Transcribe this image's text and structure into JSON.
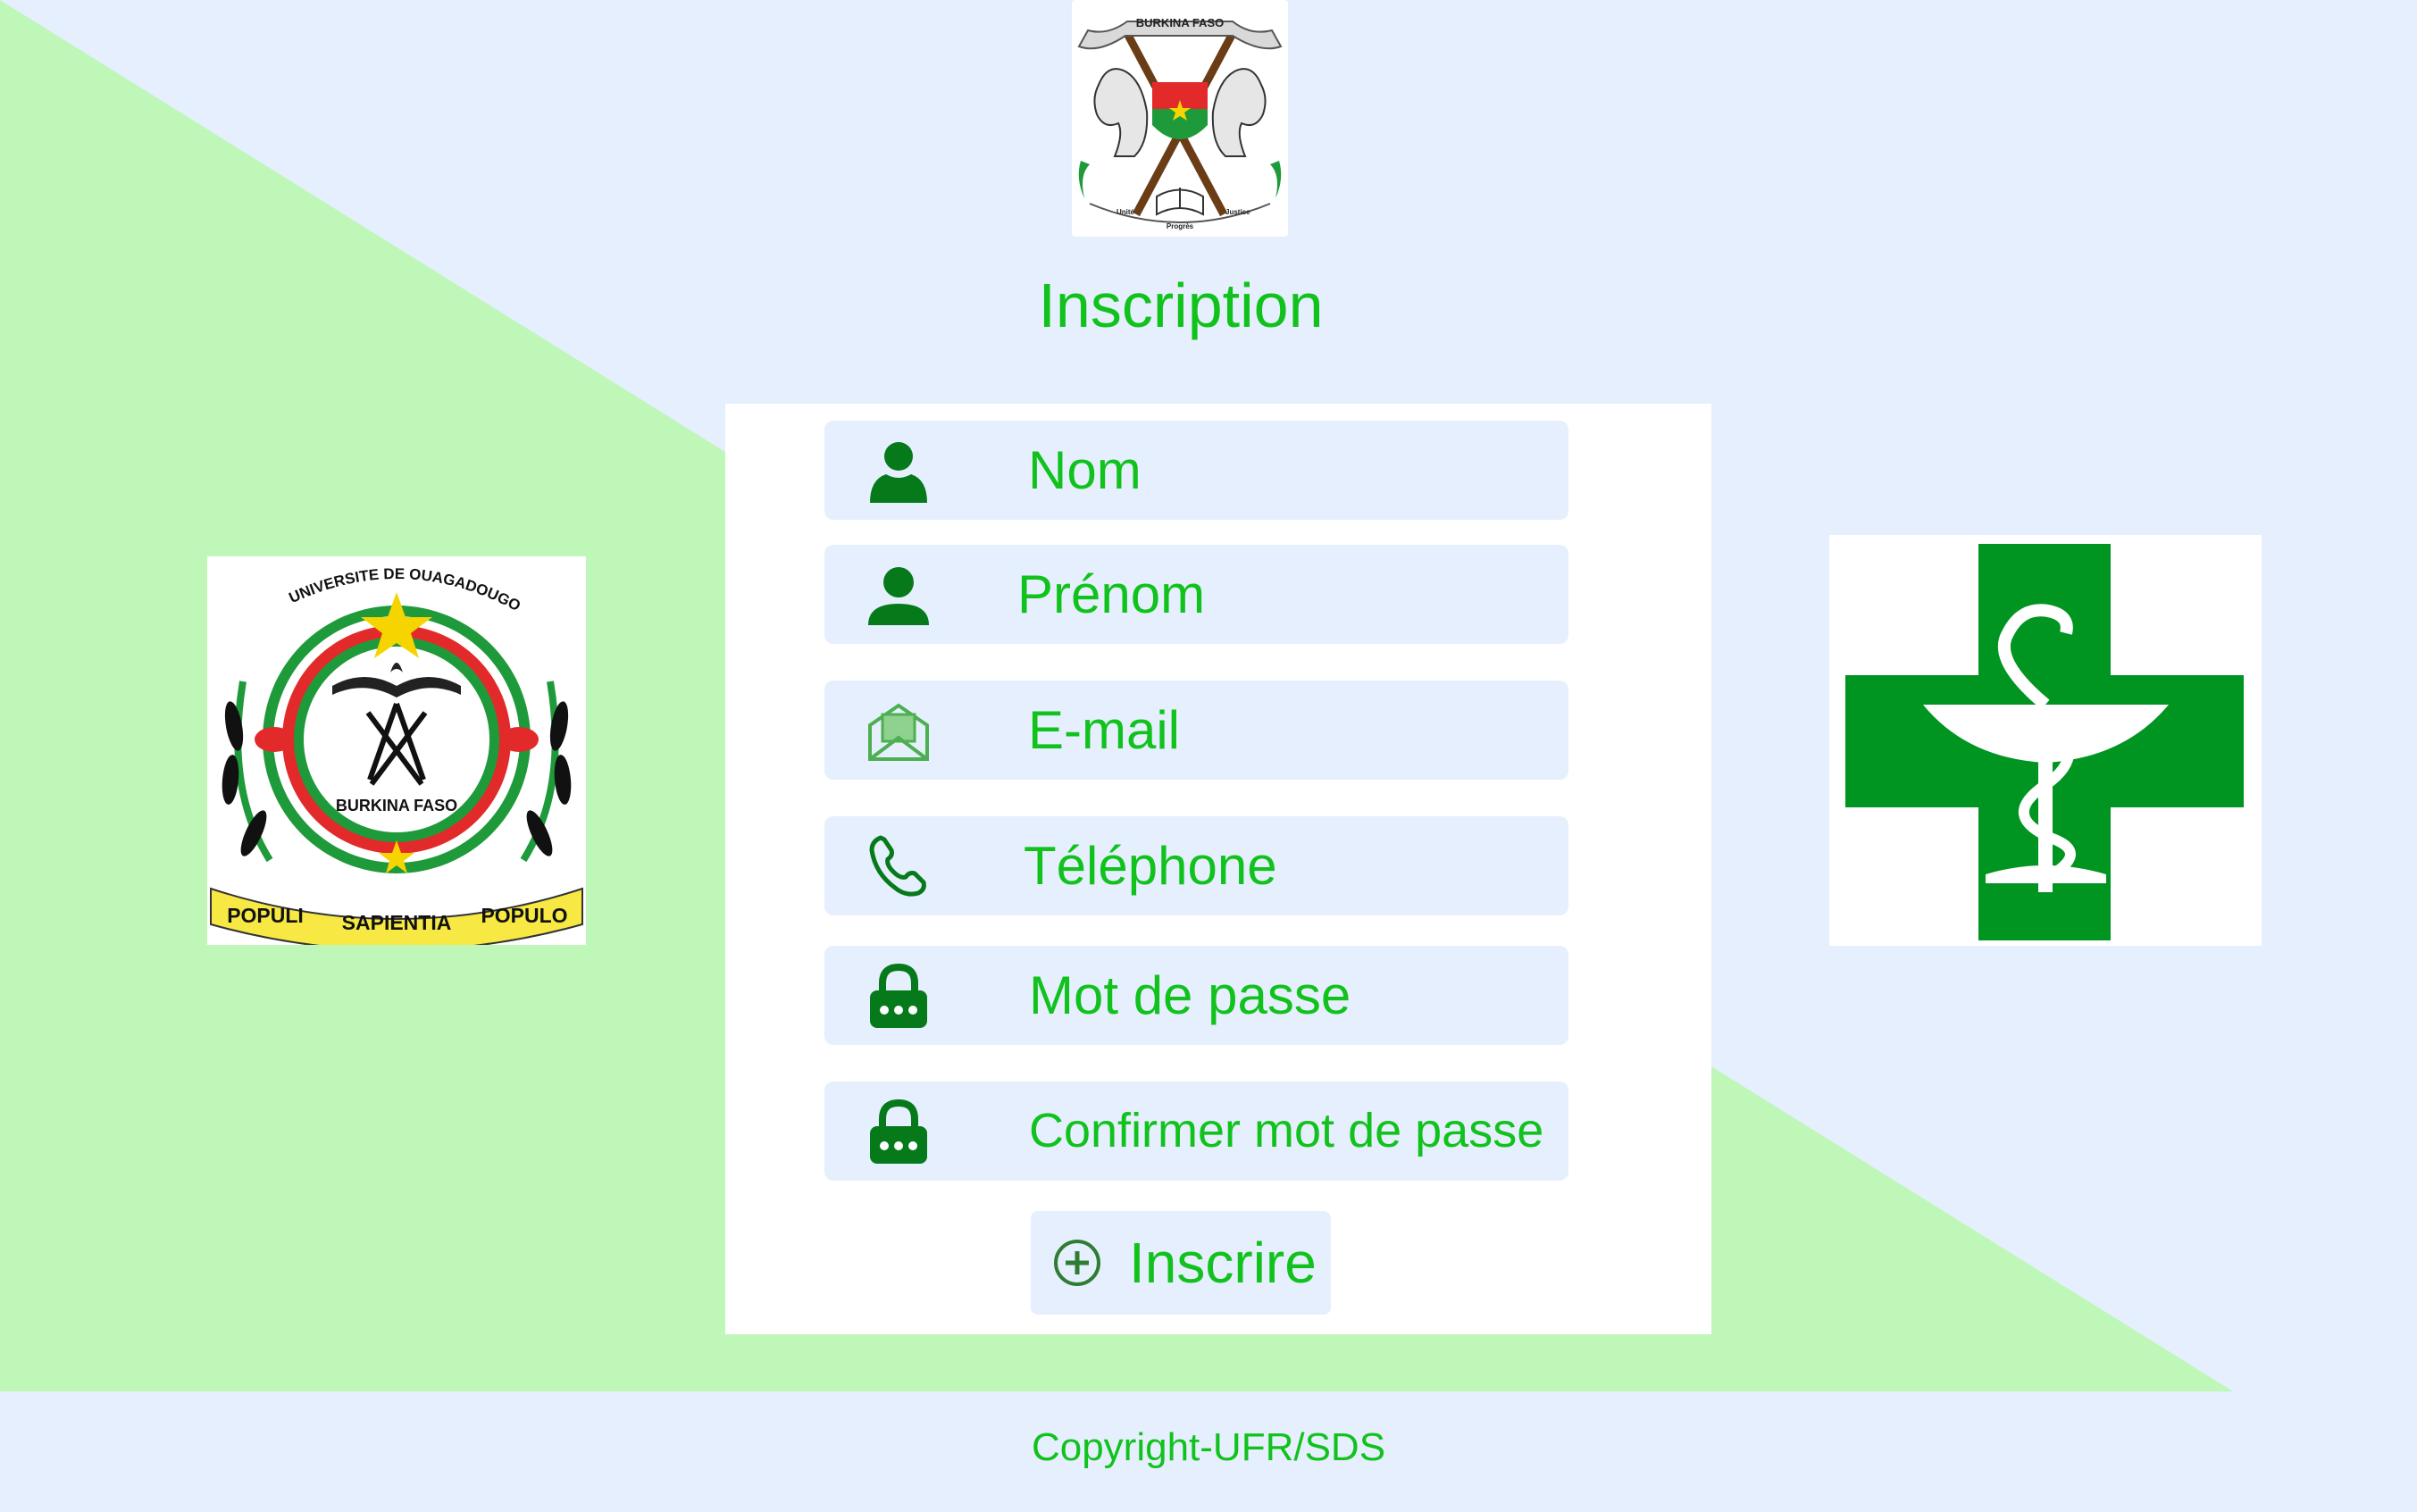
{
  "page": {
    "title": "Inscription",
    "footer": "Copyright-UFR/SDS"
  },
  "emblem": {
    "country": "BURKINA FASO",
    "motto": [
      "Unité",
      "Progrès",
      "Justice"
    ]
  },
  "university_logo": {
    "name": "UNIVERSITE DE OUAGADOUGOU",
    "country": "BURKINA FASO",
    "motto": [
      "POPULI",
      "SAPIENTIA",
      "POPULO"
    ]
  },
  "form": {
    "fields": [
      {
        "label": "Nom",
        "icon": "user-icon"
      },
      {
        "label": "Prénom",
        "icon": "person-icon"
      },
      {
        "label": "E-mail",
        "icon": "envelope-icon"
      },
      {
        "label": "Téléphone",
        "icon": "phone-icon"
      },
      {
        "label": "Mot de passe",
        "icon": "lock-icon"
      },
      {
        "label": "Confirmer mot de passe",
        "icon": "lock-icon"
      }
    ],
    "submit_label": "Inscrire",
    "submit_icon": "plus-circle-icon"
  },
  "colors": {
    "background": "#e6effd",
    "diagonal_band": "#bff7b9",
    "accent_green": "#11c21d",
    "icon_green": "#067a1a",
    "pharmacy_green": "#009521"
  }
}
